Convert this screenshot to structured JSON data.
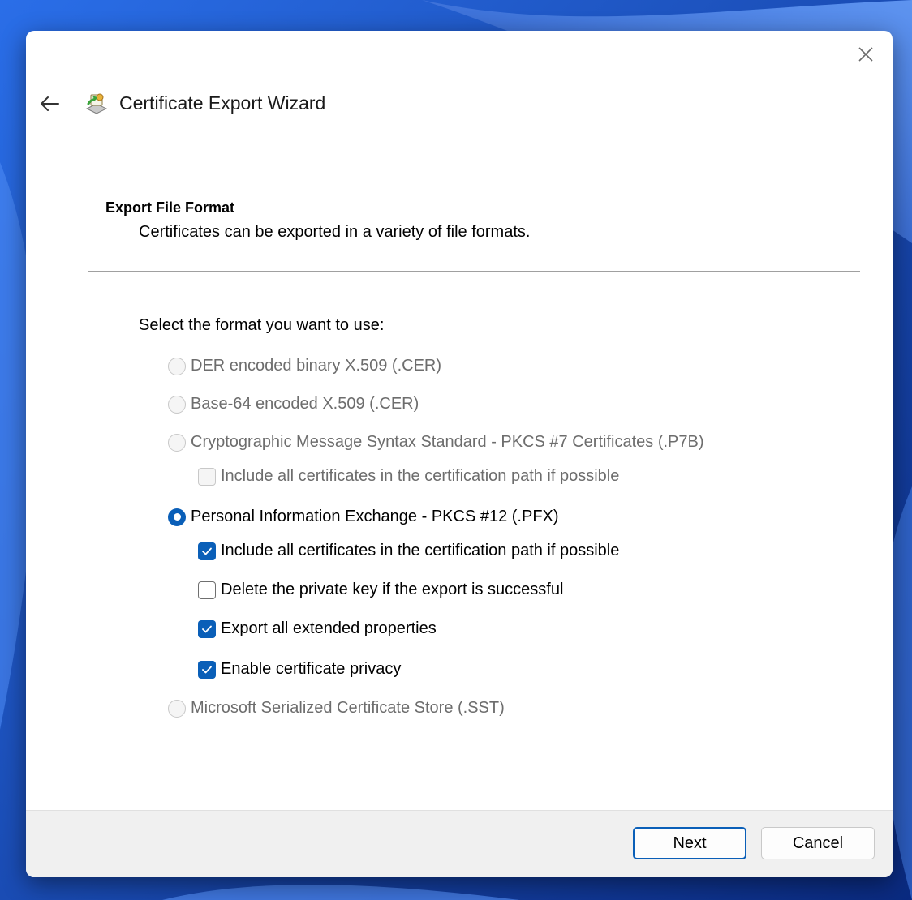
{
  "window": {
    "title": "Certificate Export Wizard",
    "close_icon": "close-icon",
    "back_icon": "back-arrow-icon",
    "app_icon": "certificate-wizard-icon"
  },
  "page": {
    "heading": "Export File Format",
    "description": "Certificates can be exported in a variety of file formats.",
    "prompt": "Select the format you want to use:"
  },
  "formats": {
    "der": {
      "label": "DER encoded binary X.509 (.CER)",
      "selected": false,
      "enabled": false
    },
    "base64": {
      "label": "Base-64 encoded X.509 (.CER)",
      "selected": false,
      "enabled": false
    },
    "pkcs7": {
      "label": "Cryptographic Message Syntax Standard - PKCS #7 Certificates (.P7B)",
      "selected": false,
      "enabled": false
    },
    "pkcs7_include": {
      "label": "Include all certificates in the certification path if possible",
      "checked": false,
      "enabled": false
    },
    "pfx": {
      "label": "Personal Information Exchange - PKCS #12 (.PFX)",
      "selected": true,
      "enabled": true
    },
    "pfx_include": {
      "label": "Include all certificates in the certification path if possible",
      "checked": true,
      "enabled": true
    },
    "pfx_delete_key": {
      "label": "Delete the private key if the export is successful",
      "checked": false,
      "enabled": true
    },
    "pfx_export_props": {
      "label": "Export all extended properties",
      "checked": true,
      "enabled": true
    },
    "pfx_privacy": {
      "label": "Enable certificate privacy",
      "checked": true,
      "enabled": true
    },
    "sst": {
      "label": "Microsoft Serialized Certificate Store (.SST)",
      "selected": false,
      "enabled": false
    }
  },
  "buttons": {
    "next": "Next",
    "cancel": "Cancel"
  },
  "colors": {
    "accent": "#0a5fb8",
    "disabled_text": "#6d6d6d",
    "footer_bg": "#f0f0f0"
  }
}
